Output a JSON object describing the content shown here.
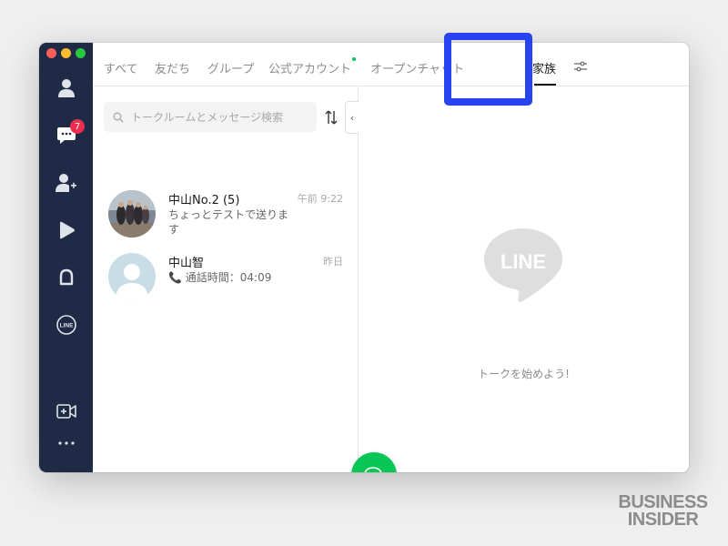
{
  "window": {
    "traffic_lights": [
      "close",
      "minimize",
      "maximize"
    ]
  },
  "sidebar": {
    "items": [
      {
        "icon": "friends-icon"
      },
      {
        "icon": "chats-icon",
        "badge": "7"
      },
      {
        "icon": "add-friend-icon"
      },
      {
        "icon": "voom-icon"
      },
      {
        "icon": "openchat-icon"
      },
      {
        "icon": "line-service-icon",
        "label": "LINE"
      },
      {
        "icon": "video-call-icon"
      },
      {
        "icon": "more-icon"
      }
    ]
  },
  "tabs": {
    "items": [
      "すべて",
      "友だち",
      "グループ",
      "公式アカウント",
      "オープンチャット",
      "家族"
    ],
    "active_index": 5,
    "settings_icon": "filter-settings-icon"
  },
  "search": {
    "placeholder": "トークルームとメッセージ検索"
  },
  "chats": [
    {
      "name": "中山No.2 (5)",
      "message": "ちょっとテストで送ります",
      "time": "午前 9:22",
      "avatar": "group-photo"
    },
    {
      "name": "中山智",
      "message": "📞 通話時間：04:09",
      "time": "昨日",
      "avatar": "default-person"
    }
  ],
  "detail": {
    "logo_text": "LINE",
    "empty_text": "トークを始めよう!"
  },
  "colors": {
    "sidebar_bg": "#1f2a47",
    "accent_green": "#06c755",
    "badge_red": "#ef2d4f",
    "highlight_blue": "#2744f0"
  },
  "watermark": {
    "line1": "BUSINESS",
    "line2": "INSIDER"
  }
}
